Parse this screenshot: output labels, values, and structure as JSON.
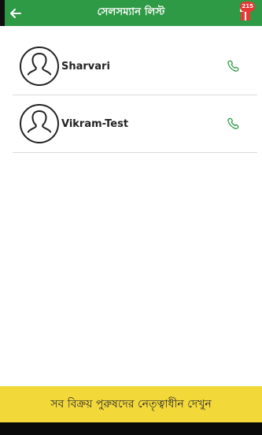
{
  "header": {
    "title": "সেলসম্যান লিস্ট",
    "badge_count": "215",
    "back_icon": "arrow-left-icon",
    "notification_icon": "gift-notification-icon",
    "background_color": "#2f9a45"
  },
  "contacts": [
    {
      "name": "Sharvari",
      "avatar_icon": "user-outline-icon",
      "call_icon": "phone-icon"
    },
    {
      "name": "Vikram-Test",
      "avatar_icon": "user-outline-icon",
      "call_icon": "phone-icon"
    }
  ],
  "bottom_bar": {
    "label": "সব বিক্রয় পুরুষদের নেতৃত্বাধীন দেখুন",
    "background_color": "#f3d83a"
  },
  "colors": {
    "accent_green": "#2f9a45",
    "call_icon_green": "#2f9a45"
  }
}
